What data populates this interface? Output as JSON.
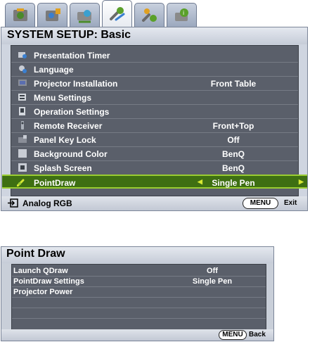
{
  "tabs": [
    {
      "icon": "picture-icon",
      "active": false
    },
    {
      "icon": "advanced-picture-icon",
      "active": false
    },
    {
      "icon": "display-icon",
      "active": false
    },
    {
      "icon": "system-setup-basic-icon",
      "active": true
    },
    {
      "icon": "system-setup-advanced-icon",
      "active": false
    },
    {
      "icon": "information-icon",
      "active": false
    }
  ],
  "main_menu": {
    "title": "SYSTEM SETUP: Basic",
    "items": [
      {
        "label": "Presentation Timer",
        "value": "",
        "icon": "timer-icon"
      },
      {
        "label": "Language",
        "value": "",
        "icon": "language-icon"
      },
      {
        "label": "Projector Installation",
        "value": "Front Table",
        "icon": "projector-installation-icon"
      },
      {
        "label": "Menu Settings",
        "value": "",
        "icon": "menu-settings-icon"
      },
      {
        "label": "Operation Settings",
        "value": "",
        "icon": "operation-settings-icon"
      },
      {
        "label": "Remote Receiver",
        "value": "Front+Top",
        "icon": "remote-receiver-icon"
      },
      {
        "label": "Panel Key Lock",
        "value": "Off",
        "icon": "panel-key-lock-icon"
      },
      {
        "label": "Background Color",
        "value": "BenQ",
        "icon": "background-color-icon"
      },
      {
        "label": "Splash Screen",
        "value": "BenQ",
        "icon": "splash-screen-icon"
      },
      {
        "label": "PointDraw",
        "value": "Single Pen",
        "icon": "pointdraw-icon",
        "selected": true
      }
    ],
    "footer": {
      "source": "Analog RGB",
      "source_icon": "input-source-icon",
      "key": "MENU",
      "action": "Exit"
    }
  },
  "sub_menu": {
    "title": "Point Draw",
    "items": [
      {
        "label": "Launch QDraw",
        "value": "Off"
      },
      {
        "label": "PointDraw Settings",
        "value": "Single Pen"
      },
      {
        "label": "Projector Power",
        "value": ""
      }
    ],
    "empty_rows": 3,
    "footer": {
      "key": "MENU",
      "action": "Back"
    }
  },
  "colors": {
    "panel_bg": "#cfd5e0",
    "list_bg": "#5a5f6a",
    "highlight_bg": "#3e6f12",
    "highlight_border": "#9acd32",
    "arrow": "#d6e832"
  }
}
